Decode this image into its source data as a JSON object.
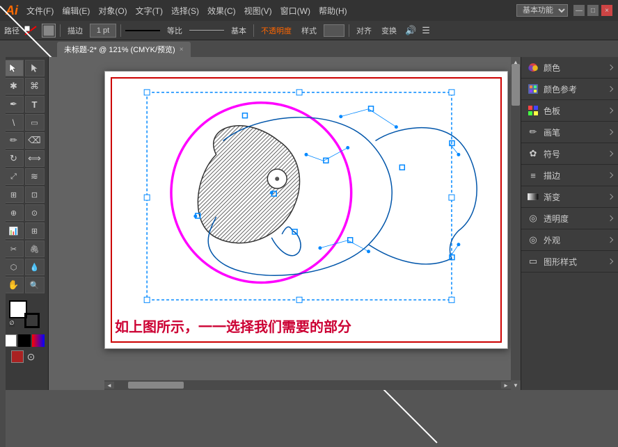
{
  "titlebar": {
    "logo": "Ai",
    "menus": [
      "文件(F)",
      "编辑(E)",
      "对象(O)",
      "文字(T)",
      "选择(S)",
      "效果(C)",
      "视图(V)",
      "窗口(W)",
      "帮助(H)"
    ],
    "mode": "基本功能",
    "win_btns": [
      "—",
      "□",
      "×"
    ]
  },
  "toolbar": {
    "path_label": "路径",
    "stroke_icon": "⬛",
    "desc_label": "描边",
    "stroke_width": "1 pt",
    "ratio_label": "等比",
    "base_label": "基本",
    "opacity_label": "不透明度",
    "style_label": "样式",
    "align_label": "对齐",
    "transform_label": "变换"
  },
  "tabbar": {
    "tab_label": "未标题-2* @ 121% (CMYK/预览)",
    "close": "×"
  },
  "left_tools": [
    {
      "name": "select",
      "symbol": "↖"
    },
    {
      "name": "direct-select",
      "symbol": "↗"
    },
    {
      "name": "pen",
      "symbol": "✒"
    },
    {
      "name": "type",
      "symbol": "T"
    },
    {
      "name": "line",
      "symbol": "\\"
    },
    {
      "name": "shape",
      "symbol": "▭"
    },
    {
      "name": "pencil",
      "symbol": "✏"
    },
    {
      "name": "brush",
      "symbol": "🖌"
    },
    {
      "name": "rotate",
      "symbol": "↻"
    },
    {
      "name": "scale",
      "symbol": "⤢"
    },
    {
      "name": "warp",
      "symbol": "≋"
    },
    {
      "name": "graph",
      "symbol": "📊"
    },
    {
      "name": "blend",
      "symbol": "⬡"
    },
    {
      "name": "eyedropper",
      "symbol": "💧"
    },
    {
      "name": "hand",
      "symbol": "✋"
    },
    {
      "name": "zoom",
      "symbol": "🔍"
    }
  ],
  "right_panel": {
    "items": [
      {
        "label": "颜色",
        "icon": "🎨",
        "type": "expand"
      },
      {
        "label": "颜色参考",
        "icon": "🎨",
        "type": "expand"
      },
      {
        "label": "色板",
        "icon": "▦",
        "type": "expand"
      },
      {
        "label": "画笔",
        "icon": "✏",
        "type": "expand"
      },
      {
        "label": "符号",
        "icon": "✿",
        "type": "expand"
      },
      {
        "label": "描边",
        "icon": "≡",
        "type": "expand"
      },
      {
        "label": "渐变",
        "icon": "▭",
        "type": "expand"
      },
      {
        "label": "透明度",
        "icon": "◎",
        "type": "expand"
      },
      {
        "label": "外观",
        "icon": "◎",
        "type": "expand"
      },
      {
        "label": "图形样式",
        "icon": "▭",
        "type": "expand"
      }
    ]
  },
  "canvas": {
    "caption": "如上图所示，一一选择我们需要的部分",
    "zoom": "121%",
    "color_mode": "CMYK/预览"
  },
  "colors": {
    "accent_pink": "#FF00FF",
    "accent_blue": "#0055AA",
    "fill_white": "#FFFFFF",
    "stroke_black": "#000000",
    "caption_color": "#CC0033"
  }
}
